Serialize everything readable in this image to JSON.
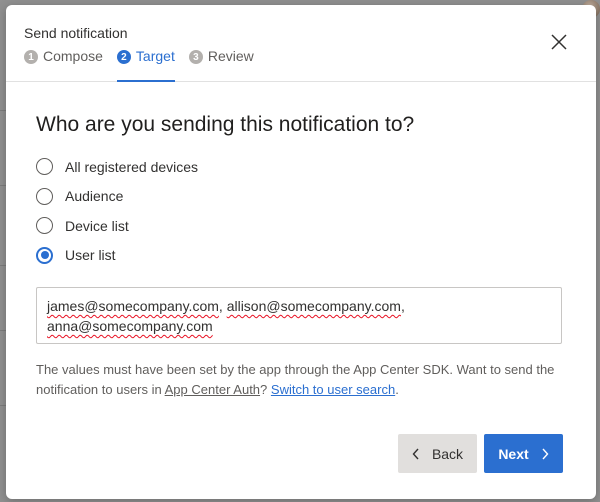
{
  "dialog": {
    "title": "Send notification",
    "close_icon": "close-icon"
  },
  "steps": [
    {
      "number": "1",
      "label": "Compose",
      "state": "done"
    },
    {
      "number": "2",
      "label": "Target",
      "state": "active"
    },
    {
      "number": "3",
      "label": "Review",
      "state": "pending"
    }
  ],
  "heading": "Who are you sending this notification to?",
  "target_options": [
    {
      "label": "All registered devices",
      "selected": false
    },
    {
      "label": "Audience",
      "selected": false
    },
    {
      "label": "Device list",
      "selected": false
    },
    {
      "label": "User list",
      "selected": true
    }
  ],
  "user_list": {
    "value": "james@somecompany.com, allison@somecompany.com, anna@somecompany.com",
    "tokens": [
      "james@somecompany.com",
      "allison@somecompany.com",
      "anna@somecompany.com"
    ]
  },
  "help": {
    "text_1": "The values must have been set by the app through the App Center SDK.",
    "text_2": "Want to send the notification to users in",
    "auth_link": "App Center Auth",
    "question_mark": "?",
    "switch_link": "Switch to user search",
    "period": "."
  },
  "buttons": {
    "back": "Back",
    "next": "Next"
  },
  "colors": {
    "accent": "#2b6fd0",
    "spellcheck": "#e81123"
  }
}
